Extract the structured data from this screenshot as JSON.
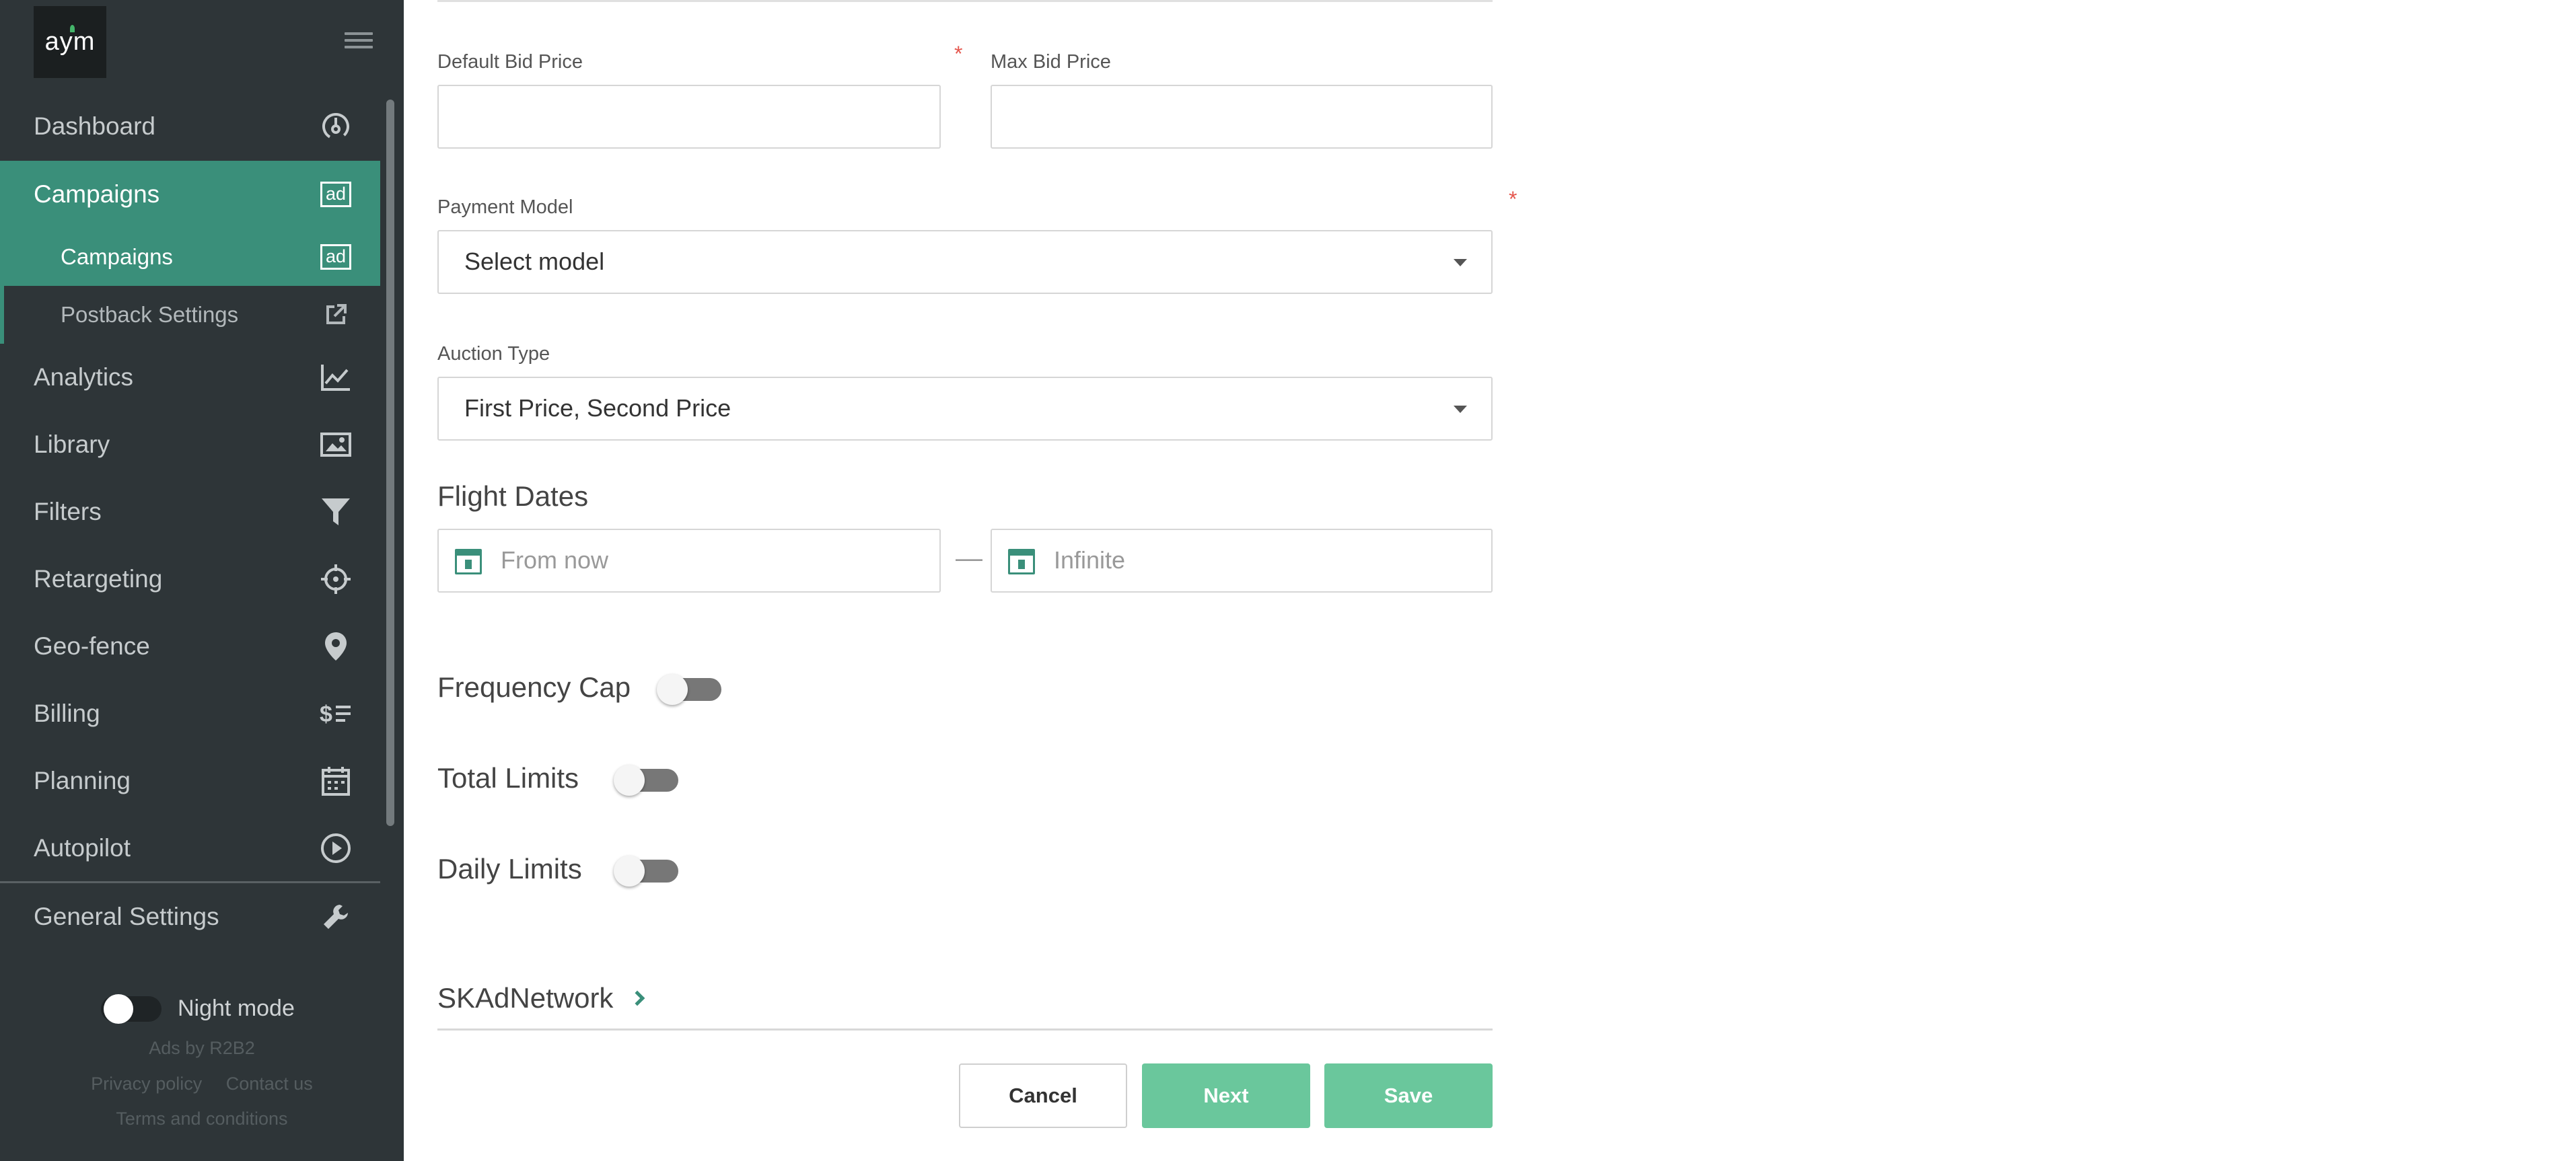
{
  "brand": {
    "logo_text": "aym"
  },
  "sidebar": {
    "items": [
      {
        "label": "Dashboard",
        "icon": "dashboard-icon"
      },
      {
        "label": "Campaigns",
        "icon": "ad-icon",
        "badge": "ad"
      },
      {
        "label": "Campaigns",
        "icon": "ad-icon",
        "badge": "ad"
      },
      {
        "label": "Postback Settings",
        "icon": "external-link-icon"
      },
      {
        "label": "Analytics",
        "icon": "chart-icon"
      },
      {
        "label": "Library",
        "icon": "image-icon"
      },
      {
        "label": "Filters",
        "icon": "filter-icon"
      },
      {
        "label": "Retargeting",
        "icon": "crosshair-icon"
      },
      {
        "label": "Geo-fence",
        "icon": "location-pin-icon"
      },
      {
        "label": "Billing",
        "icon": "billing-icon"
      },
      {
        "label": "Planning",
        "icon": "calendar-icon"
      },
      {
        "label": "Autopilot",
        "icon": "play-circle-icon"
      },
      {
        "label": "General Settings",
        "icon": "wrench-icon"
      }
    ],
    "night_mode_label": "Night mode",
    "night_mode_on": false,
    "ads_by": "Ads by R2B2",
    "privacy_policy": "Privacy policy",
    "contact_us": "Contact us",
    "terms": "Terms and conditions"
  },
  "form": {
    "default_bid_label": "Default Bid Price",
    "default_bid_value": "",
    "max_bid_label": "Max Bid Price",
    "max_bid_value": "",
    "required_mark": "*",
    "payment_model_label": "Payment Model",
    "payment_model_value": "Select model",
    "auction_type_label": "Auction Type",
    "auction_type_value": "First Price, Second Price",
    "flight_dates_heading": "Flight Dates",
    "flight_from_placeholder": "From now",
    "flight_to_placeholder": "Infinite",
    "date_separator": "—",
    "frequency_cap_label": "Frequency Cap",
    "frequency_cap_on": false,
    "total_limits_label": "Total Limits",
    "total_limits_on": false,
    "daily_limits_label": "Daily Limits",
    "daily_limits_on": false,
    "skadnetwork_label": "SKAdNetwork"
  },
  "actions": {
    "cancel": "Cancel",
    "next": "Next",
    "save": "Save"
  },
  "colors": {
    "sidebar_bg": "#2e3538",
    "accent": "#3a8f7a",
    "button_green": "#6ac79c",
    "required": "#e5584f"
  }
}
